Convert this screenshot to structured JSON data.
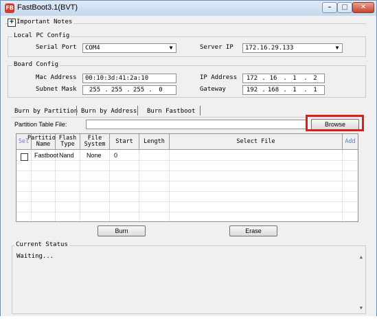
{
  "window": {
    "title": "FastBoot3.1(BVT)",
    "min_glyph": "–",
    "max_glyph": "□",
    "close_glyph": "✕",
    "app_icon_text": "FB"
  },
  "notes": {
    "toggle": "+",
    "label": "Important Notes"
  },
  "local_pc": {
    "label": "Local PC Config",
    "serial_port_label": "Serial Port",
    "serial_port_value": "COM4",
    "server_ip_label": "Server IP",
    "server_ip_value": "172.16.29.133",
    "arrow": "▼"
  },
  "board": {
    "label": "Board Config",
    "mac_label": "Mac Address",
    "mac_value": "00:10:3d:41:2a:10",
    "ip_label": "IP Address",
    "ip_octets": [
      "172",
      "16",
      "1",
      "2"
    ],
    "subnet_label": "Subnet Mask",
    "subnet_octets": [
      "255",
      "255",
      "255",
      "0"
    ],
    "gateway_label": "Gateway",
    "gateway_octets": [
      "192",
      "168",
      "1",
      "1"
    ],
    "dot": "."
  },
  "tabs": [
    "Burn by Partition",
    "Burn by Address",
    "Burn Fastboot"
  ],
  "partition_table": {
    "label": "Partition Table File:",
    "value": "",
    "browse": "Browse"
  },
  "table": {
    "headers": {
      "sel": "Sel",
      "partition_name": [
        "Partition",
        "Name"
      ],
      "flash_type": [
        "Flash",
        "Type"
      ],
      "file_system": [
        "File",
        "System"
      ],
      "start": "Start",
      "length": "Length",
      "select_file": "Select File",
      "add": "Add"
    },
    "rows": [
      {
        "partition_name": "Fastboot",
        "flash_type": "Nand",
        "file_system": "None",
        "start": "0",
        "length": "",
        "select_file": ""
      }
    ]
  },
  "actions": {
    "burn": "Burn",
    "erase": "Erase"
  },
  "status": {
    "label": "Current Status",
    "text": "Waiting..."
  },
  "colors": {
    "highlight": "#e01b1b",
    "header_blue": "#5b7fbf"
  }
}
